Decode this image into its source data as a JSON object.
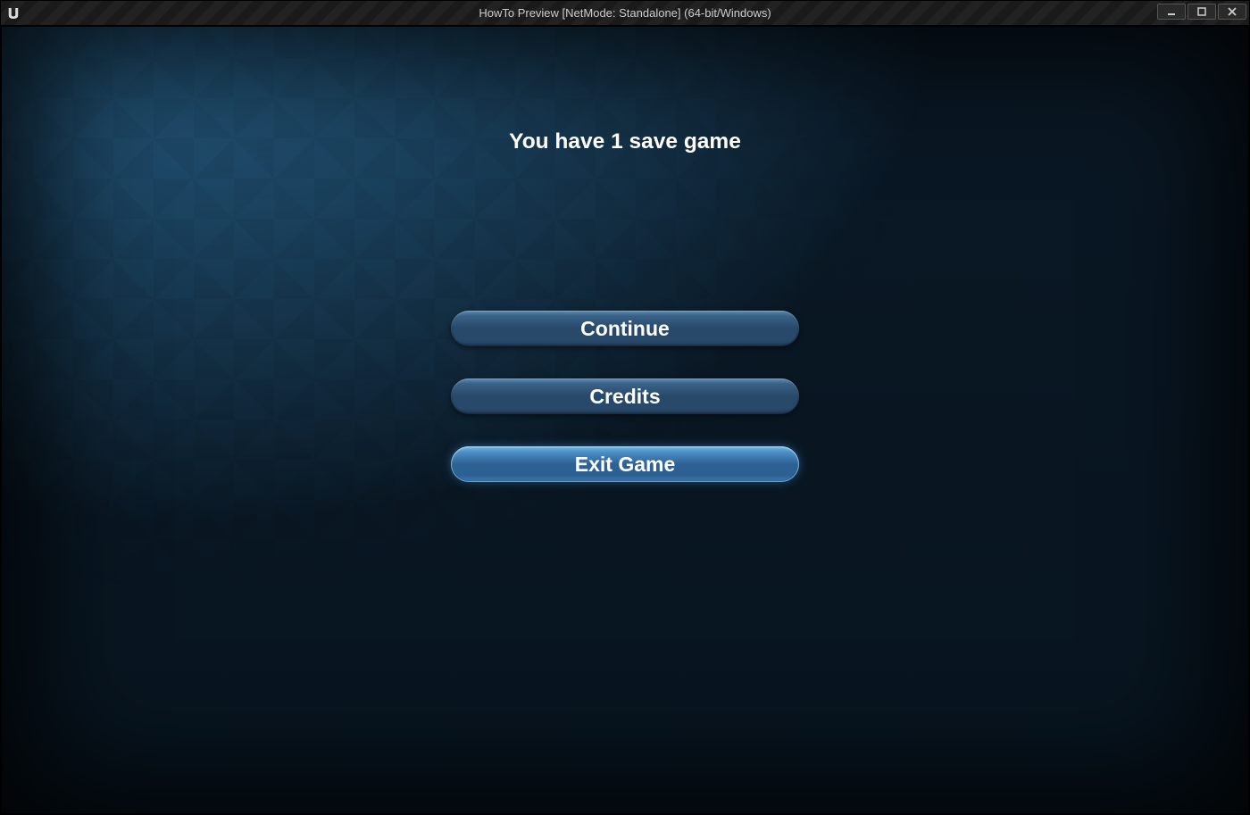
{
  "window": {
    "title": "HowTo Preview [NetMode: Standalone]  (64-bit/Windows)"
  },
  "menu": {
    "heading": "You have 1 save game",
    "buttons": {
      "continue": "Continue",
      "credits": "Credits",
      "exit": "Exit Game"
    }
  }
}
